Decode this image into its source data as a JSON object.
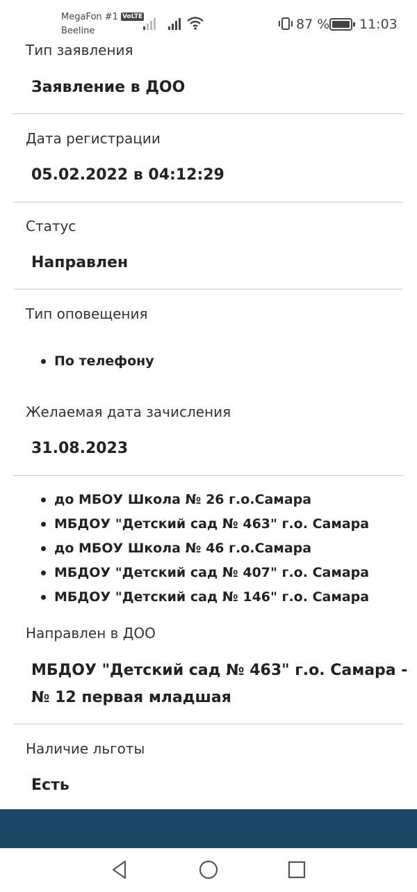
{
  "status_bar": {
    "carrier1": "MegaFon #1",
    "volte": "VoLTE",
    "carrier2": "Beeline",
    "battery_percent": "87 %",
    "time": "11:03"
  },
  "fields": {
    "application_type": {
      "label": "Тип заявления",
      "value": "Заявление в ДОО"
    },
    "registration_date": {
      "label": "Дата регистрации",
      "value": "05.02.2022 в 04:12:29"
    },
    "status": {
      "label": "Статус",
      "value": "Направлен"
    },
    "notification_type": {
      "label": "Тип оповещения",
      "items": [
        "По телефону"
      ]
    },
    "desired_enrollment_date": {
      "label": "Желаемая дата зачисления",
      "value": "31.08.2023"
    },
    "preferred_institutions": [
      "до МБОУ Школа № 26 г.о.Самара",
      "МБДОУ \"Детский сад № 463\" г.о. Самара",
      "до МБОУ Школа № 46 г.о.Самара",
      "МБДОУ \"Детский сад № 407\" г.о. Самара",
      "МБДОУ \"Детский сад № 146\" г.о. Самара"
    ],
    "directed_to": {
      "label": "Направлен в ДОО",
      "value": "МБДОУ \"Детский сад № 463\" г.о. Самара - № 12 первая младшая"
    },
    "benefit": {
      "label": "Наличие льготы",
      "value": "Есть"
    }
  },
  "colors": {
    "bottom_band": "#1d4a66",
    "divider": "#c8c8c8"
  },
  "nav_icons": [
    "back-icon",
    "home-icon",
    "recents-icon"
  ]
}
